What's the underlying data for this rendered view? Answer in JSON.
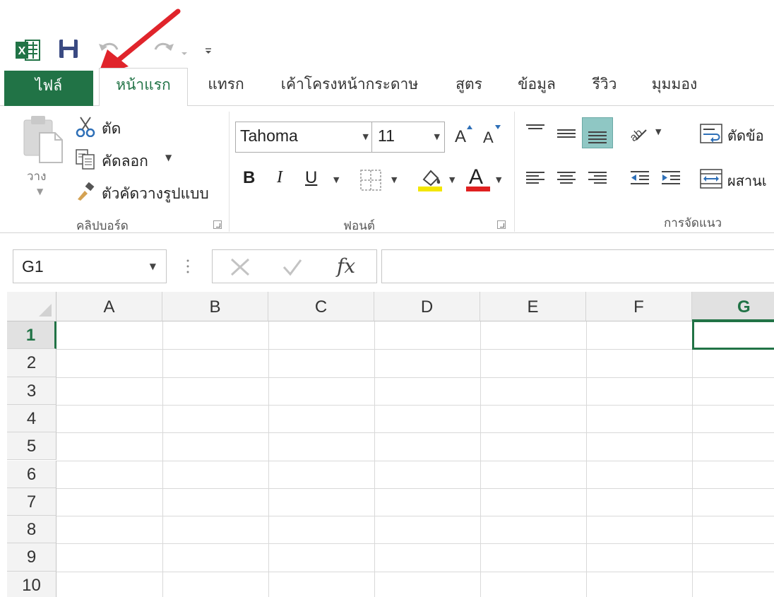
{
  "quick_access": {
    "app_icon": "excel-logo-icon",
    "save_icon": "save-icon",
    "undo_icon": "undo-icon",
    "redo_icon": "redo-icon",
    "customize_icon": "customize-toolbar-icon"
  },
  "tabs": [
    {
      "label": "ไฟล์"
    },
    {
      "label": "หน้าแรก"
    },
    {
      "label": "แทรก"
    },
    {
      "label": "เค้าโครงหน้ากระดาษ"
    },
    {
      "label": "สูตร"
    },
    {
      "label": "ข้อมูล"
    },
    {
      "label": "รีวิว"
    },
    {
      "label": "มุมมอง"
    }
  ],
  "ribbon": {
    "clipboard": {
      "paste_label": "วาง",
      "cut_label": "ตัด",
      "copy_label": "คัดลอก",
      "format_painter_label": "ตัวคัดวางรูปแบบ",
      "group_label": "คลิปบอร์ด"
    },
    "font": {
      "font_name": "Tahoma",
      "font_size": "11",
      "grow_label": "A",
      "shrink_label": "A",
      "bold_label": "B",
      "italic_label": "I",
      "underline_label": "U",
      "font_color_label": "A",
      "fill_color": "#f3e600",
      "font_color": "#e02020",
      "group_label": "ฟอนต์"
    },
    "alignment": {
      "wrap_text_label": "ตัดข้อ",
      "merge_label": "ผสานเ",
      "group_label": "การจัดแนว"
    }
  },
  "formula_bar": {
    "name_box": "G1",
    "fx_label": "fx",
    "formula": ""
  },
  "sheet": {
    "columns": [
      "A",
      "B",
      "C",
      "D",
      "E",
      "F",
      "G"
    ],
    "rows": [
      "1",
      "2",
      "3",
      "4",
      "5",
      "6",
      "7",
      "8",
      "9",
      "10"
    ],
    "active_cell": "G1"
  },
  "colors": {
    "accent": "#217346",
    "annotation_arrow": "#e0242b"
  }
}
